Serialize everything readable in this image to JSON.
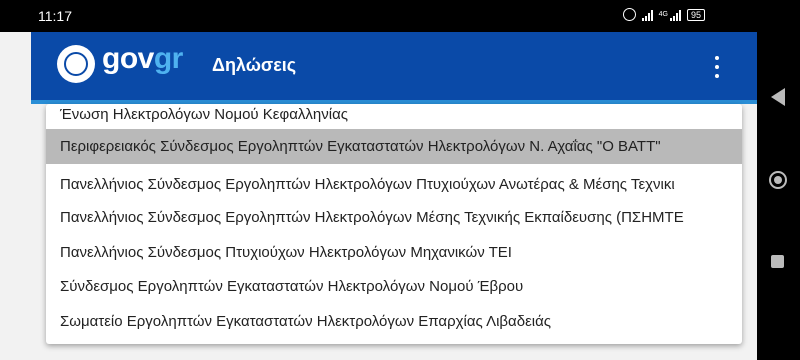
{
  "statusbar": {
    "time": "11:17",
    "network_label": "4G",
    "battery": "95"
  },
  "appbar": {
    "brand_prefix": "gov",
    "brand_suffix": "gr",
    "title": "Δηλώσεις",
    "background": "#0a4aa8",
    "accent": "#4fb2f0"
  },
  "options": [
    "Ένωση Ηλεκτρολόγων Νομού Κεφαλληνίας",
    "Περιφερειακός Σύνδεσμος Εργοληπτών Εγκαταστατών Ηλεκτρολόγων Ν. Αχαΐας \"Ο ΒΑΤΤ\"",
    "Πανελλήνιος Σύνδεσμος Εργοληπτών Ηλεκτρολόγων Πτυχιούχων Ανωτέρας & Μέσης Τεχνικι",
    "Πανελλήνιος Σύνδεσμος Εργοληπτών Ηλεκτρολόγων Μέσης Τεχνικής Εκπαίδευσης (ΠΣΗΜΤΕ",
    "Πανελλήνιος Σύνδεσμος Πτυχιούχων Ηλεκτρολόγων Μηχανικών ΤΕΙ",
    "Σύνδεσμος Εργοληπτών Εγκαταστατών Ηλεκτρολόγων Νομού Έβρου",
    "Σωματείο Εργοληπτών Εγκαταστατών Ηλεκτρολόγων Επαρχίας Λιβαδειάς"
  ],
  "icons": {
    "alarm": "alarm-icon",
    "signal": "signal-icon",
    "battery": "battery-icon",
    "logo": "greek-emblem-icon",
    "menu": "more-vert-icon",
    "back": "nav-back-icon",
    "home": "nav-home-icon",
    "recents": "nav-recents-icon"
  }
}
